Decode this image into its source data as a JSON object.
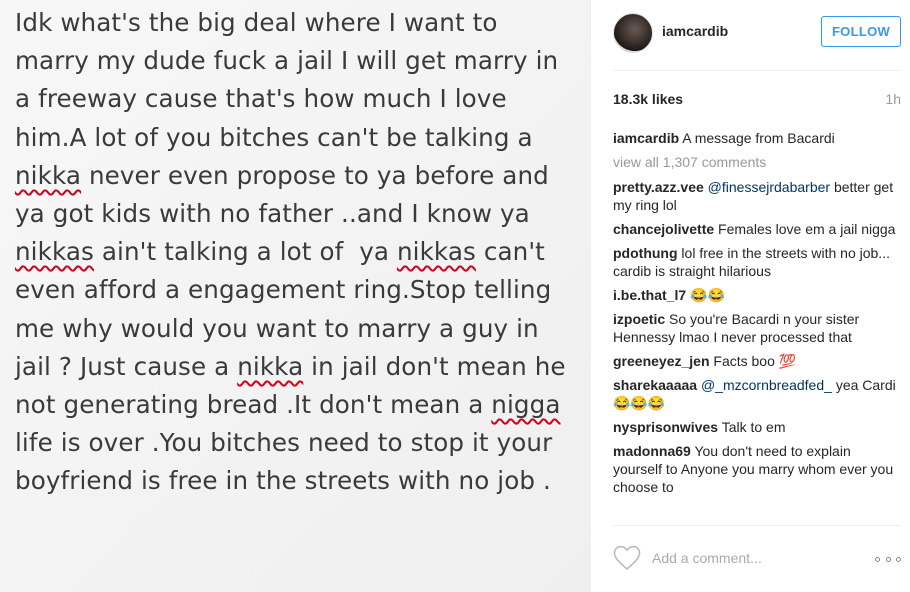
{
  "post": {
    "text_segments": [
      {
        "text": "Idk what's the big deal where I want to marry my dude fuck a jail I will get marry in a freeway cause that's how much I love him.A lot of you bitches can't be talking a ",
        "spell": false
      },
      {
        "text": "nikka",
        "spell": true
      },
      {
        "text": " never even propose to ya before and  ya got kids with no father ..and I know ya ",
        "spell": false
      },
      {
        "text": "nikkas",
        "spell": true
      },
      {
        "text": " ain't talking a lot of  ya ",
        "spell": false
      },
      {
        "text": "nikkas",
        "spell": true
      },
      {
        "text": " can't even afford a engagement ring.Stop telling me why would you want to marry a guy in jail ? Just cause a ",
        "spell": false
      },
      {
        "text": "nikka",
        "spell": true
      },
      {
        "text": " in jail don't mean he not generating bread .It don't mean a ",
        "spell": false
      },
      {
        "text": "nigga",
        "spell": true
      },
      {
        "text": " life is over .You bitches need to stop it your boyfriend is free in the streets with no job .",
        "spell": false
      }
    ]
  },
  "header": {
    "username": "iamcardib",
    "follow_label": "FOLLOW"
  },
  "meta": {
    "likes": "18.3k likes",
    "time": "1h"
  },
  "caption": {
    "user": "iamcardib",
    "text": "A message from Bacardi"
  },
  "view_all": "view all 1,307 comments",
  "comments": [
    {
      "user": "pretty.azz.vee",
      "mention": "@finessejrdabarber",
      "text": "better get my ring lol"
    },
    {
      "user": "chancejolivette",
      "mention": "",
      "text": "Females love em a jail nigga"
    },
    {
      "user": "pdothung",
      "mention": "",
      "text": "lol free in the streets with no job... cardib is straight hilarious"
    },
    {
      "user": "i.be.that_l7",
      "mention": "",
      "text": "😂😂"
    },
    {
      "user": "izpoetic",
      "mention": "",
      "text": "So you're Bacardi n your sister Hennessy lmao I never processed that"
    },
    {
      "user": "greeneyez_jen",
      "mention": "",
      "text": "Facts boo 💯"
    },
    {
      "user": "sharekaaaaa",
      "mention": "@_mzcornbreadfed_",
      "text": "yea Cardi 😂😂😂"
    },
    {
      "user": "nysprisonwives",
      "mention": "",
      "text": "Talk to em"
    },
    {
      "user": "madonna69",
      "mention": "",
      "text": "You don't need to explain yourself to Anyone you marry whom ever you choose to"
    }
  ],
  "footer": {
    "add_comment_placeholder": "Add a comment...",
    "heart_icon": "heart-outline-icon",
    "more_icon": "more-options-icon"
  },
  "colors": {
    "link_blue": "#3897f0",
    "mention_blue": "#003569",
    "muted_gray": "#999999",
    "spell_red": "#d0021b"
  }
}
